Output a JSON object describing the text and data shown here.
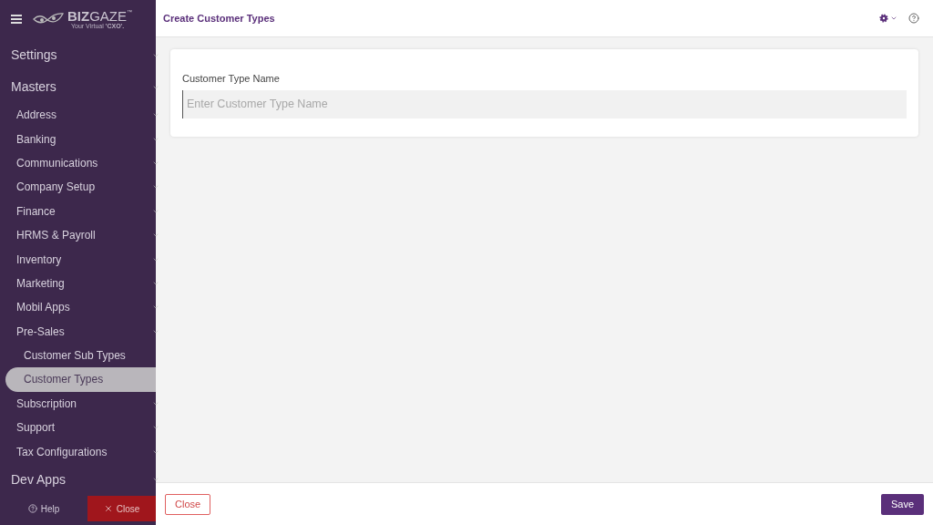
{
  "logo": {
    "brand_bold": "BIZ",
    "brand_light": "GAZE",
    "trademark": "™",
    "tagline": "Your Virtual **'CXO'.**"
  },
  "sidebar": {
    "items": [
      {
        "kind": "section",
        "label": "Settings",
        "expandable": true,
        "selected": false
      },
      {
        "kind": "section",
        "label": "Masters",
        "expandable": true,
        "selected": false,
        "children": [
          {
            "label": "Address",
            "expandable": true,
            "selected": false
          },
          {
            "label": "Banking",
            "expandable": true,
            "selected": false
          },
          {
            "label": "Communications",
            "expandable": true,
            "selected": false
          },
          {
            "label": "Company Setup",
            "expandable": true,
            "selected": false
          },
          {
            "label": "Finance",
            "expandable": true,
            "selected": false
          },
          {
            "label": "HRMS & Payroll",
            "expandable": true,
            "selected": false
          },
          {
            "label": "Inventory",
            "expandable": true,
            "selected": false
          },
          {
            "label": "Marketing",
            "expandable": true,
            "selected": false
          },
          {
            "label": "Mobil Apps",
            "expandable": true,
            "selected": false
          },
          {
            "label": "Pre-Sales",
            "expandable": true,
            "selected": false,
            "children": [
              {
                "label": "Customer Sub Types",
                "expandable": false,
                "selected": false
              },
              {
                "label": "Customer Types",
                "expandable": false,
                "selected": true
              }
            ]
          },
          {
            "label": "Subscription",
            "expandable": true,
            "selected": false
          },
          {
            "label": "Support",
            "expandable": true,
            "selected": false
          },
          {
            "label": "Tax Configurations",
            "expandable": true,
            "selected": false
          }
        ]
      },
      {
        "kind": "section",
        "label": "Dev Apps",
        "expandable": true,
        "selected": false
      }
    ],
    "help": "Help",
    "close": "Close"
  },
  "page": {
    "title": "Create Customer Types"
  },
  "form": {
    "field_label": "Customer Type Name",
    "placeholder": "Enter Customer Type Name"
  },
  "footer": {
    "close": "Close",
    "save": "Save"
  }
}
